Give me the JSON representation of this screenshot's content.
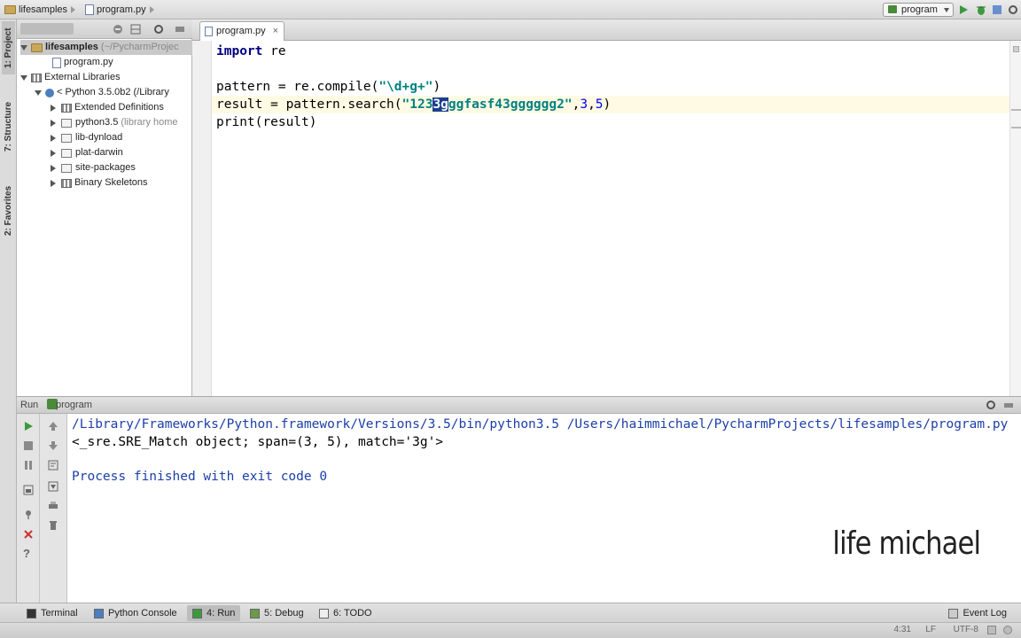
{
  "navbar": {
    "project": "lifesamples",
    "file": "program.py",
    "run_config": "program"
  },
  "left_strip": {
    "project_tab": "1: Project",
    "structure_tab": "7: Structure",
    "favorites_tab": "2: Favorites"
  },
  "project_panel": {
    "tree": [
      {
        "label": "lifesamples",
        "hint": "(~/PycharmProjec",
        "level": 0,
        "expanded": true,
        "kind": "folder"
      },
      {
        "label": "program.py",
        "hint": "",
        "level": 1,
        "kind": "file"
      },
      {
        "label": "External Libraries",
        "hint": "",
        "level": 0,
        "expanded": true,
        "kind": "lib"
      },
      {
        "label": "< Python 3.5.0b2",
        "hint": "(/Library",
        "level": 1,
        "expanded": true,
        "kind": "python"
      },
      {
        "label": "Extended Definitions",
        "hint": "",
        "level": 2,
        "expanded": false,
        "kind": "lib"
      },
      {
        "label": "python3.5",
        "hint": "(library home",
        "level": 2,
        "expanded": false,
        "kind": "folder"
      },
      {
        "label": "lib-dynload",
        "hint": "",
        "level": 2,
        "expanded": false,
        "kind": "folder"
      },
      {
        "label": "plat-darwin",
        "hint": "",
        "level": 2,
        "expanded": false,
        "kind": "folder"
      },
      {
        "label": "site-packages",
        "hint": "",
        "level": 2,
        "expanded": false,
        "kind": "folder"
      },
      {
        "label": "Binary Skeletons",
        "hint": "",
        "level": 2,
        "expanded": false,
        "kind": "lib"
      }
    ]
  },
  "editor": {
    "tab_label": "program.py",
    "lines": {
      "l1_kw": "import",
      "l1_rest": " re",
      "l3_a": "pattern = re.compile(",
      "l3_str": "\"\\d+g+\"",
      "l3_b": ")",
      "l4_a": "result = pattern.search(",
      "l4_str1": "\"123",
      "l4_sel": "3g",
      "l4_str2": "ggfasf43gggggg2\"",
      "l4_b": ",",
      "l4_n1": "3",
      "l4_c": ",",
      "l4_n2": "5",
      "l4_d": ")",
      "l5": "print(result)"
    }
  },
  "run_panel": {
    "header_prefix": "Run",
    "header_name": "program",
    "output": {
      "cmd": "/Library/Frameworks/Python.framework/Versions/3.5/bin/python3.5 /Users/haimmichael/PycharmProjects/lifesamples/program.py",
      "result": "<_sre.SRE_Match object; span=(3, 5), match='3g'>",
      "finished": "Process finished with exit code 0"
    },
    "watermark": "life michael"
  },
  "bottom_bar": {
    "terminal": "Terminal",
    "python_console": "Python Console",
    "run": "4: Run",
    "debug": "5: Debug",
    "todo": "6: TODO",
    "event_log": "Event Log"
  },
  "status_bar": {
    "position": "4:31",
    "line_sep": "LF",
    "encoding": "UTF-8"
  },
  "colors": {
    "keyword": "#000080",
    "string": "#008080",
    "number": "#0000ff",
    "selection": "#1a3f8f",
    "console_text": "#1c3fa8"
  }
}
